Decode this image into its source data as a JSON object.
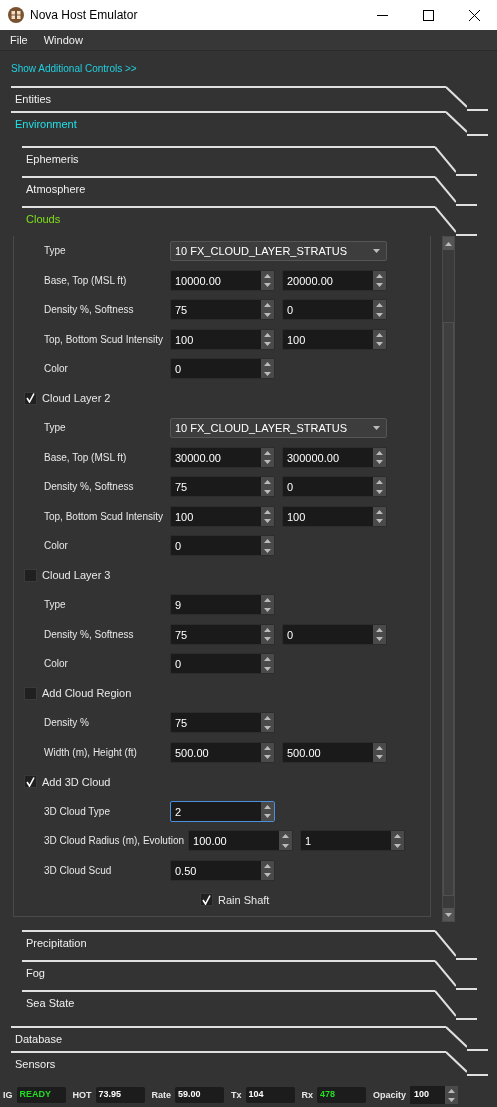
{
  "window": {
    "title": "Nova Host Emulator"
  },
  "menu": [
    "File",
    "Window"
  ],
  "additional_controls_link": "Show Additional Controls >>",
  "sections": [
    {
      "label": "Entities",
      "expanded": false
    },
    {
      "label": "Environment",
      "expanded": true,
      "children": [
        {
          "label": "Ephemeris",
          "expanded": false
        },
        {
          "label": "Atmosphere",
          "expanded": false
        },
        {
          "label": "Clouds",
          "expanded": true,
          "rows": [
            {
              "kind": "field",
              "label": "Type",
              "fields": [
                {
                  "kind": "dropdown",
                  "value": "10 FX_CLOUD_LAYER_STRATUS",
                  "focused": false
                }
              ]
            },
            {
              "kind": "field",
              "label": "Base, Top (MSL ft)",
              "fields": [
                {
                  "kind": "spin",
                  "value": "10000.00",
                  "focused": false
                },
                {
                  "kind": "spin",
                  "value": "20000.00",
                  "focused": false
                }
              ]
            },
            {
              "kind": "field",
              "label": "Density %, Softness",
              "fields": [
                {
                  "kind": "spin",
                  "value": "75",
                  "focused": false
                },
                {
                  "kind": "spin",
                  "value": "0",
                  "focused": false
                }
              ]
            },
            {
              "kind": "field",
              "label": "Top, Bottom Scud Intensity",
              "fields": [
                {
                  "kind": "spin",
                  "value": "100",
                  "focused": false
                },
                {
                  "kind": "spin",
                  "value": "100",
                  "focused": false
                }
              ]
            },
            {
              "kind": "field",
              "label": "Color",
              "fields": [
                {
                  "kind": "spin",
                  "value": "0",
                  "focused": false
                }
              ]
            },
            {
              "kind": "checkbox",
              "label": "Cloud Layer 2",
              "checked": true
            },
            {
              "kind": "field",
              "label": "Type",
              "fields": [
                {
                  "kind": "dropdown",
                  "value": "10 FX_CLOUD_LAYER_STRATUS",
                  "focused": false
                }
              ]
            },
            {
              "kind": "field",
              "label": "Base, Top (MSL ft)",
              "fields": [
                {
                  "kind": "spin",
                  "value": "30000.00",
                  "focused": false
                },
                {
                  "kind": "spin",
                  "value": "300000.00",
                  "focused": false
                }
              ]
            },
            {
              "kind": "field",
              "label": "Density %, Softness",
              "fields": [
                {
                  "kind": "spin",
                  "value": "75",
                  "focused": false
                },
                {
                  "kind": "spin",
                  "value": "0",
                  "focused": false
                }
              ]
            },
            {
              "kind": "field",
              "label": "Top, Bottom Scud Intensity",
              "fields": [
                {
                  "kind": "spin",
                  "value": "100",
                  "focused": false
                },
                {
                  "kind": "spin",
                  "value": "100",
                  "focused": false
                }
              ]
            },
            {
              "kind": "field",
              "label": "Color",
              "fields": [
                {
                  "kind": "spin",
                  "value": "0",
                  "focused": false
                }
              ]
            },
            {
              "kind": "checkbox",
              "label": "Cloud Layer 3",
              "checked": false
            },
            {
              "kind": "field",
              "label": "Type",
              "fields": [
                {
                  "kind": "spin",
                  "value": "9",
                  "focused": false
                }
              ]
            },
            {
              "kind": "field",
              "label": "Density %, Softness",
              "fields": [
                {
                  "kind": "spin",
                  "value": "75",
                  "focused": false
                },
                {
                  "kind": "spin",
                  "value": "0",
                  "focused": false
                }
              ]
            },
            {
              "kind": "field",
              "label": "Color",
              "fields": [
                {
                  "kind": "spin",
                  "value": "0",
                  "focused": false
                }
              ]
            },
            {
              "kind": "checkbox",
              "label": "Add Cloud Region",
              "checked": false
            },
            {
              "kind": "field",
              "label": "Density %",
              "fields": [
                {
                  "kind": "spin",
                  "value": "75",
                  "focused": false
                }
              ]
            },
            {
              "kind": "field",
              "label": "Width (m), Height (ft)",
              "fields": [
                {
                  "kind": "spin",
                  "value": "500.00",
                  "focused": false
                },
                {
                  "kind": "spin",
                  "value": "500.00",
                  "focused": false
                }
              ]
            },
            {
              "kind": "checkbox",
              "label": "Add 3D Cloud",
              "checked": true
            },
            {
              "kind": "field",
              "label": "3D Cloud Type",
              "fields": [
                {
                  "kind": "spin",
                  "value": "2",
                  "focused": true
                }
              ]
            },
            {
              "kind": "field",
              "label": "3D Cloud Radius (m), Evolution",
              "fields": [
                {
                  "kind": "spin",
                  "value": "100.00",
                  "focused": false
                },
                {
                  "kind": "spin",
                  "value": "1",
                  "focused": false
                }
              ]
            },
            {
              "kind": "field",
              "label": "3D Cloud Scud",
              "fields": [
                {
                  "kind": "spin",
                  "value": "0.50",
                  "focused": false
                }
              ]
            },
            {
              "kind": "sub_checkbox",
              "label": "Rain Shaft",
              "checked": true
            }
          ]
        },
        {
          "label": "Precipitation",
          "expanded": false
        },
        {
          "label": "Fog",
          "expanded": false
        },
        {
          "label": "Sea State",
          "expanded": false
        }
      ]
    },
    {
      "label": "Database",
      "expanded": false
    },
    {
      "label": "Sensors",
      "expanded": false
    }
  ],
  "status_bar": [
    {
      "label": "IG",
      "value": "READY",
      "color": "#22dd22",
      "kind": "text"
    },
    {
      "label": "HOT",
      "value": "73.95",
      "color": "#ffffff",
      "kind": "text"
    },
    {
      "label": "Rate",
      "value": "59.00",
      "color": "#ffffff",
      "kind": "text"
    },
    {
      "label": "Tx",
      "value": "104",
      "color": "#ffffff",
      "kind": "text"
    },
    {
      "label": "Rx",
      "value": "478",
      "color": "#22dd22",
      "kind": "text"
    },
    {
      "label": "Opacity",
      "value": "100",
      "color": "#ffffff",
      "kind": "spin"
    }
  ]
}
